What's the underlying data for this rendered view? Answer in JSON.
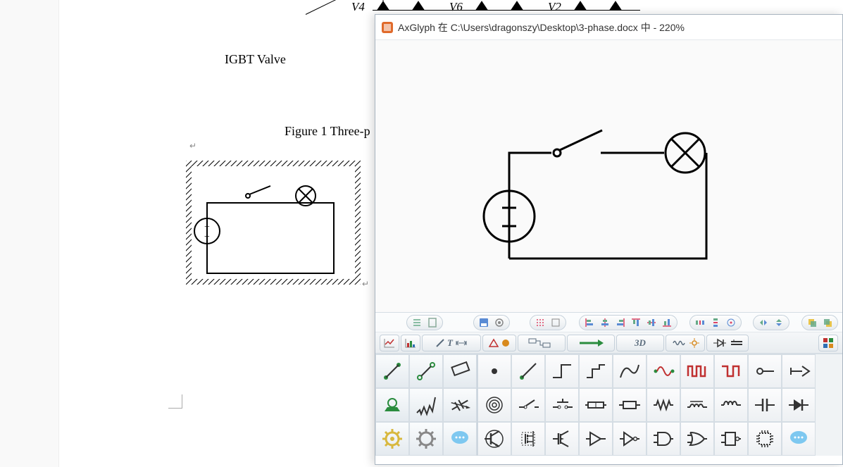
{
  "doc": {
    "v4": "V4",
    "v6": "V6",
    "v2": "V2",
    "igbt_label": "IGBT Valve",
    "fig_caption": "Figure 1 Three-p",
    "return_mark": "↵",
    "return_mark2": "↵"
  },
  "window": {
    "title": "AxGlyph 在 C:\\Users\\dragonszy\\Desktop\\3-phase.docx 中 - 220%"
  },
  "toolbar_row1_groups": [
    {
      "name": "doc-ops",
      "items": [
        "list",
        "page"
      ]
    },
    {
      "name": "file-ops",
      "items": [
        "save",
        "gear"
      ]
    },
    {
      "name": "grid-ops",
      "items": [
        "grid",
        "snap"
      ]
    },
    {
      "name": "align-ops",
      "items": [
        "al1",
        "al2",
        "al3",
        "al4",
        "al5",
        "al6"
      ]
    },
    {
      "name": "dist-ops",
      "items": [
        "d1",
        "d2",
        "d3"
      ]
    },
    {
      "name": "flip-ops",
      "items": [
        "f1",
        "f2"
      ]
    },
    {
      "name": "layer-ops",
      "items": [
        "l1",
        "l2"
      ]
    }
  ],
  "categories": [
    {
      "name": "chart-line",
      "icon": "chart-line"
    },
    {
      "name": "chart-bar",
      "icon": "chart-bar"
    },
    {
      "name": "pencil",
      "label": "",
      "icons": [
        "pencil",
        "T",
        "resize"
      ]
    },
    {
      "name": "shapes",
      "icons": [
        "triangle",
        "circle"
      ]
    },
    {
      "name": "flow",
      "icons": [
        "flow"
      ]
    },
    {
      "name": "arrow",
      "icons": [
        "arrow"
      ]
    },
    {
      "name": "3d",
      "label": "3D"
    },
    {
      "name": "spring",
      "icons": [
        "spring",
        "sun"
      ]
    },
    {
      "name": "circuit",
      "icons": [
        "diode",
        "ground"
      ]
    },
    {
      "name": "palette",
      "icons": [
        "palette"
      ]
    }
  ],
  "palette_left": [
    "line-dot",
    "line-open",
    "rect-tilt",
    "mount",
    "resistor-z",
    "cap-tilt",
    "gear-y",
    "gear-gray",
    "chat"
  ],
  "palette_right": [
    [
      "dot",
      "wire-g",
      "step1",
      "step2",
      "curve",
      "sine",
      "pulse-r",
      "sq-r",
      "node-o",
      "gnd-arrow"
    ],
    [
      "coil",
      "switch",
      "sw-no",
      "bus",
      "box",
      "res",
      "ind1",
      "ind2",
      "cap",
      "diode2"
    ],
    [
      "bjt",
      "fet1",
      "fet2",
      "buf",
      "inv",
      "and",
      "or",
      "nand",
      "chip",
      "chat2"
    ]
  ]
}
